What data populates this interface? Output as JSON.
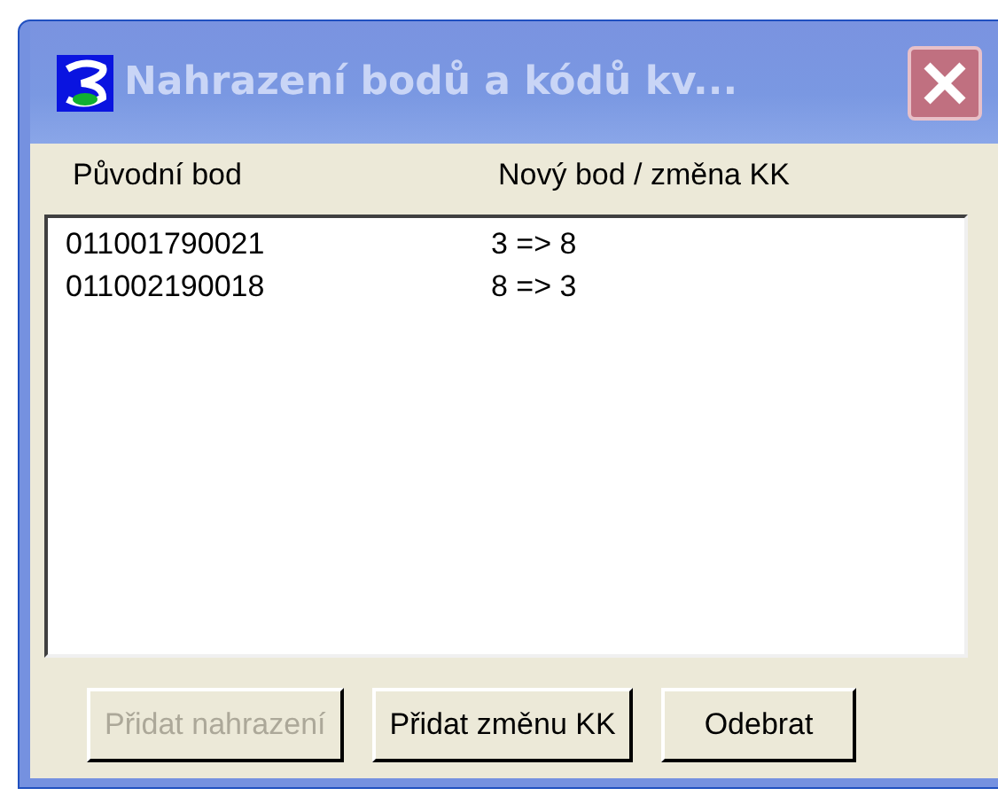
{
  "window": {
    "title": "Nahrazení bodů a kódů kv..."
  },
  "columns": [
    "Původní bod",
    "Nový bod / změna KK"
  ],
  "rows": [
    {
      "original": "011001790021",
      "new": "3 => 8",
      "selected": false
    },
    {
      "original": "011002190018",
      "new": "8 => 3",
      "selected": false
    }
  ],
  "buttons": [
    {
      "label": "Přidat nahrazení",
      "disabled": true
    },
    {
      "label": "Přidat změnu KK",
      "disabled": false
    },
    {
      "label": "Odebrat",
      "disabled": false
    }
  ]
}
